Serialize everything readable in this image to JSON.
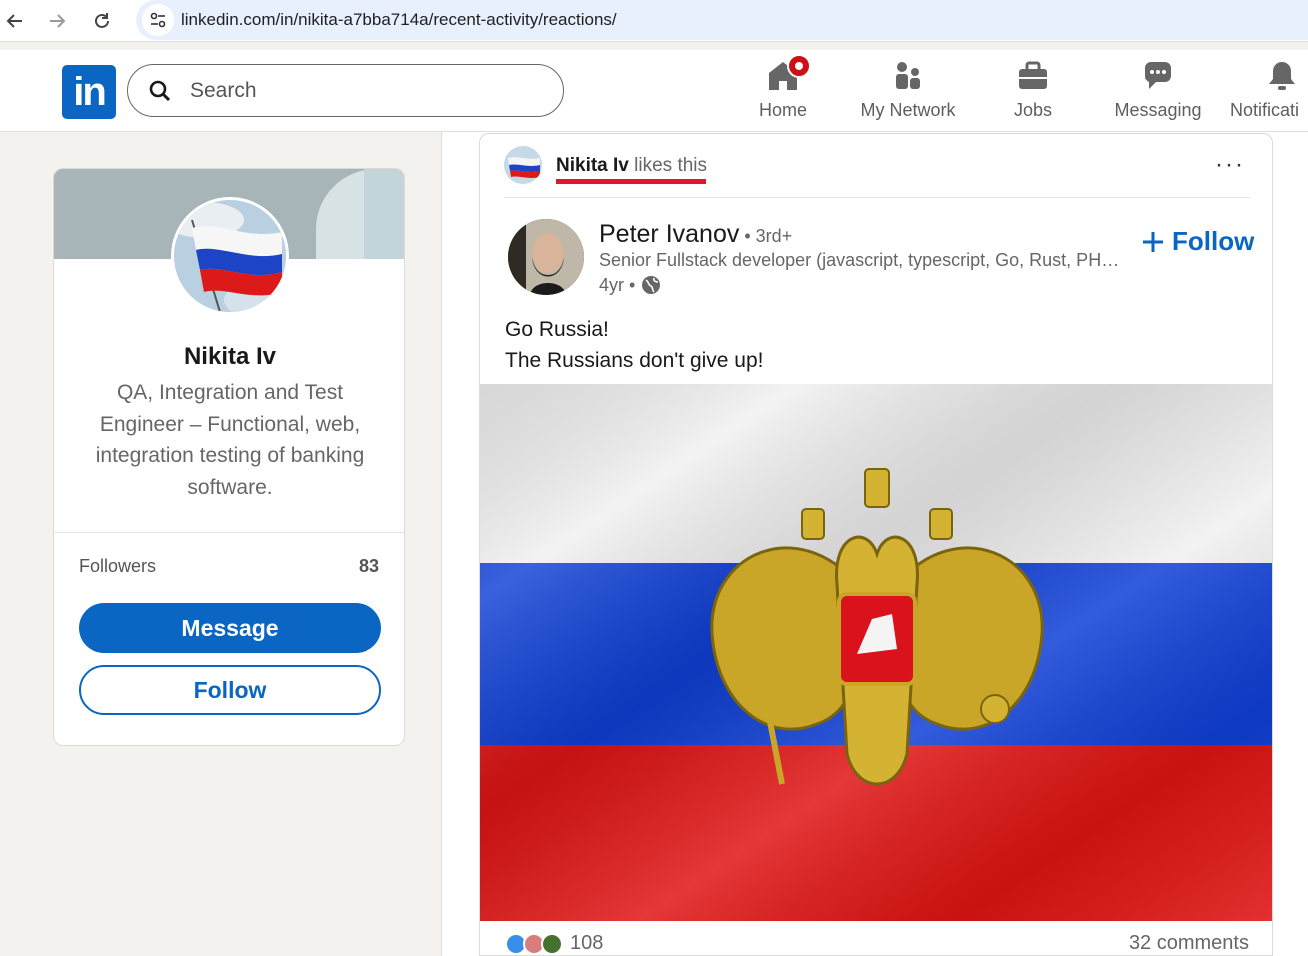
{
  "browser": {
    "url": "linkedin.com/in/nikita-a7bba714a/recent-activity/reactions/"
  },
  "header": {
    "logo": "in",
    "search_placeholder": "Search",
    "nav": [
      {
        "label": "Home",
        "icon": "home-icon"
      },
      {
        "label": "My Network",
        "icon": "network-icon"
      },
      {
        "label": "Jobs",
        "icon": "briefcase-icon"
      },
      {
        "label": "Messaging",
        "icon": "messaging-icon"
      },
      {
        "label": "Notificati",
        "icon": "bell-icon"
      }
    ]
  },
  "profile": {
    "name": "Nikita Iv",
    "headline": "QA, Integration and Test Engineer – Functional, web, integration testing of banking software.",
    "followers_label": "Followers",
    "followers_count": "83",
    "message_label": "Message",
    "follow_label": "Follow"
  },
  "activity": {
    "actor": "Nikita Iv",
    "verb": " likes this",
    "more": "···"
  },
  "post": {
    "author": "Peter Ivanov",
    "degree": " • 3rd+",
    "title": "Senior Fullstack developer (javascript, typescript, Go, Rust, PHP, Python)",
    "age": "4yr •",
    "follow_label": "Follow",
    "text_line1": "Go Russia!",
    "text_line2": "The Russians don't give up!",
    "reactions_count": "108",
    "comments": "32 comments"
  },
  "colors": {
    "brand": "#0a66c2",
    "notification": "#cc1016",
    "underline": "#e0182a",
    "flag_white": "#f2f2f2",
    "flag_blue": "#0f3fd6",
    "flag_red": "#e01414"
  }
}
